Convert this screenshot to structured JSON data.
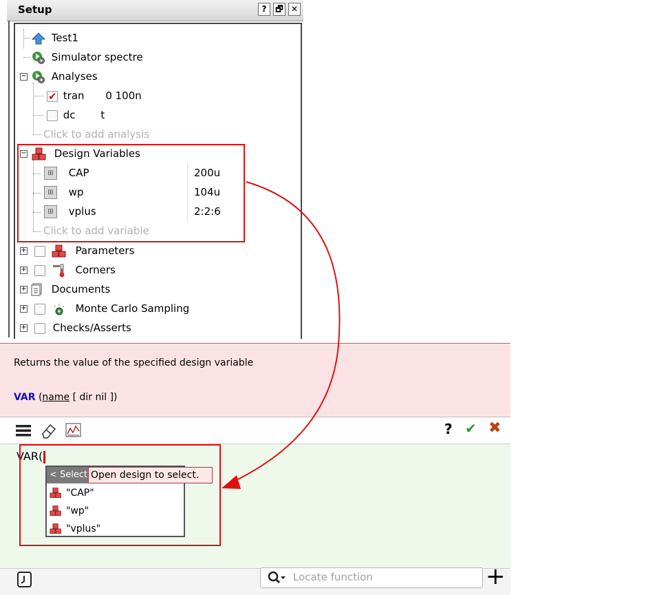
{
  "setup": {
    "title": "Setup",
    "window_buttons": [
      "?",
      "🗗",
      "✕"
    ],
    "items": {
      "test": "Test1",
      "simulator": "Simulator spectre",
      "analyses": "Analyses",
      "analysis_tran": {
        "name": "tran",
        "value": "0 100n",
        "checked": true
      },
      "analysis_dc": {
        "name": "dc",
        "value": "t",
        "checked": false
      },
      "add_analysis_hint": "Click to add analysis",
      "design_variables": "Design Variables",
      "variables": [
        {
          "name": "CAP",
          "value": "200u"
        },
        {
          "name": "wp",
          "value": "104u"
        },
        {
          "name": "vplus",
          "value": "2:2:6"
        }
      ],
      "add_variable_hint": "Click to add variable",
      "parameters": "Parameters",
      "corners": "Corners",
      "documents": "Documents",
      "monte_carlo": "Monte Carlo Sampling",
      "checks": "Checks/Asserts"
    }
  },
  "description": {
    "text": "Returns the value of the specified design variable",
    "fn_name": "VAR",
    "open_paren": " (",
    "arg": "name",
    "rest": " [ dir nil ])"
  },
  "toolbar": {
    "help": "?",
    "accept": "✔",
    "cancel": "✖"
  },
  "editor": {
    "text": "VAR(",
    "popup_first": "< Select",
    "tooltip": "Open design to select.",
    "suggestions": [
      "\"CAP\"",
      "\"wp\"",
      "\"vplus\""
    ]
  },
  "bottom": {
    "locate_placeholder": "Locate function",
    "add": "+"
  },
  "colors": {
    "highlight": "#e01010",
    "description_bg": "#fbe3e5",
    "editor_bg": "#eef9ec"
  }
}
